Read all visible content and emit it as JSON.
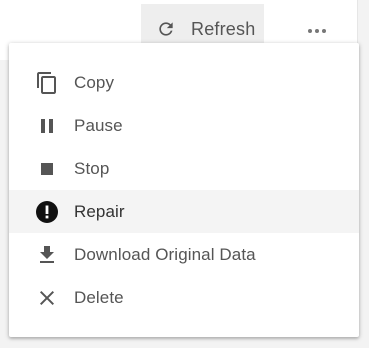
{
  "toolbar": {
    "refresh_label": "Refresh",
    "refresh_icon": "refresh-icon",
    "more_icon": "more-horizontal-icon"
  },
  "menu": {
    "items": [
      {
        "label": "Copy",
        "icon": "copy-icon"
      },
      {
        "label": "Pause",
        "icon": "pause-icon"
      },
      {
        "label": "Stop",
        "icon": "stop-icon"
      },
      {
        "label": "Repair",
        "icon": "alert-circle-icon",
        "highlighted": true
      },
      {
        "label": "Download Original Data",
        "icon": "download-icon"
      },
      {
        "label": "Delete",
        "icon": "close-icon"
      }
    ]
  },
  "colors": {
    "icon": "#555555",
    "text": "#555555",
    "highlight_bg": "#f4f4f4",
    "refresh_bg": "#eeeeee"
  }
}
